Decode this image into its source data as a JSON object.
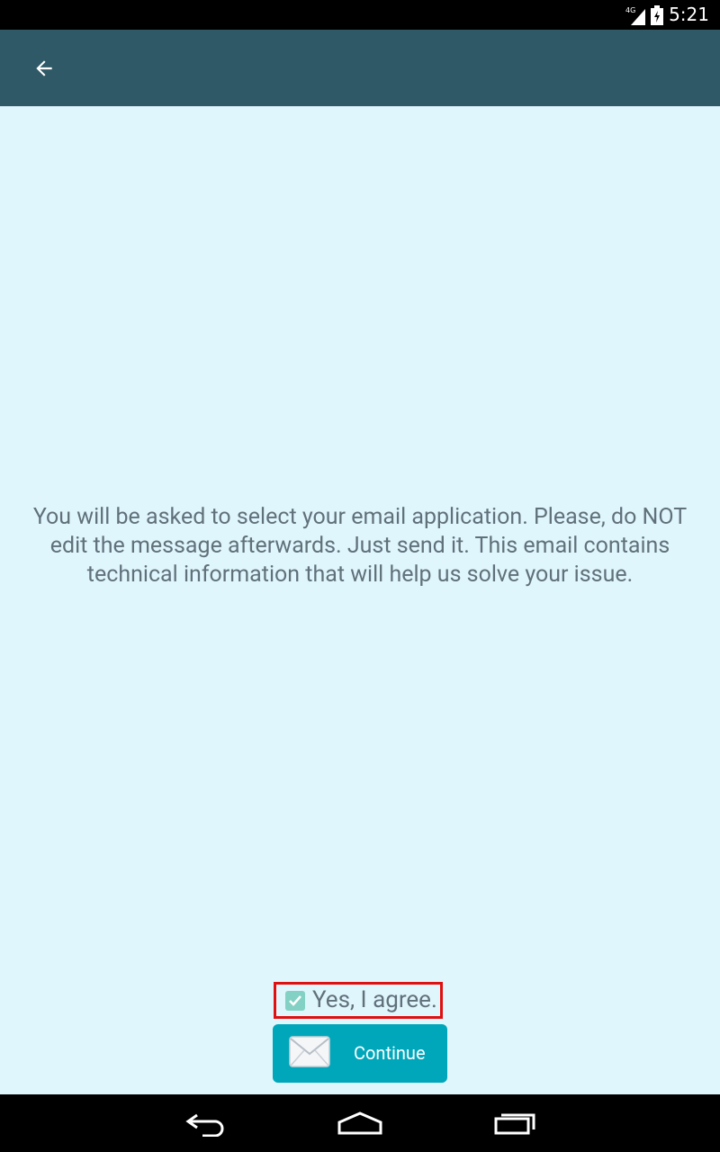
{
  "status_bar": {
    "network": "4G",
    "time": "5:21"
  },
  "app_bar": {
    "back_icon": "arrow-left-icon"
  },
  "message": {
    "line1": "You will be asked to select your email application. Please, do NOT",
    "line2": "edit the message afterwards. Just send it. This email contains",
    "line3": "technical information that will help us solve your issue."
  },
  "agree": {
    "label": "Yes, I agree.",
    "checked": true
  },
  "continue_button": {
    "label": "Continue",
    "icon": "envelope-icon"
  },
  "nav_bar": {
    "back": "back-icon",
    "home": "home-icon",
    "recents": "recents-icon"
  },
  "colors": {
    "app_bar": "#2f5966",
    "background": "#dff6fd",
    "button": "#00a7bb",
    "highlight": "#e01010",
    "text": "#61717b"
  }
}
